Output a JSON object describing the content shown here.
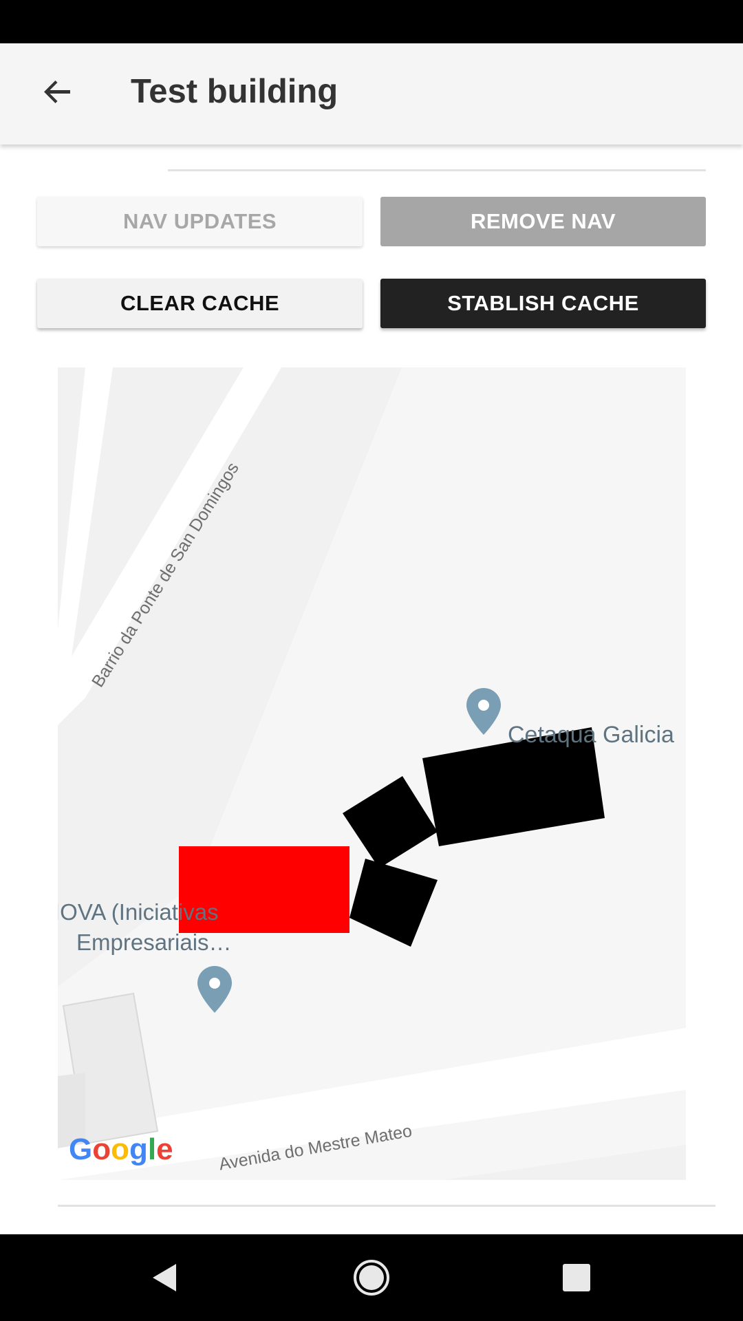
{
  "app_bar": {
    "title": "Test building",
    "back_icon": "arrow-left-icon"
  },
  "buttons": {
    "nav_updates": "NAV UPDATES",
    "remove_nav": "REMOVE NAV",
    "clear_cache": "CLEAR CACHE",
    "stablish_cache": "STABLISH CACHE"
  },
  "map": {
    "street_1": "Barrio da Ponte de San Domingos",
    "street_2": "Avenida do Mestre Mateo",
    "place_1": "Cetaqua Galicia",
    "place_2_line1": "IOVA (Iniciativas",
    "place_2_line2": "Empresariais…",
    "logo": "Google",
    "colors": {
      "selected_building": "#ff0000",
      "buildings": "#000000",
      "pin": "#7a9eb4"
    }
  },
  "system_nav": {
    "back_icon": "nav-back-triangle-icon",
    "home_icon": "nav-home-circle-icon",
    "recents_icon": "nav-recents-square-icon"
  }
}
